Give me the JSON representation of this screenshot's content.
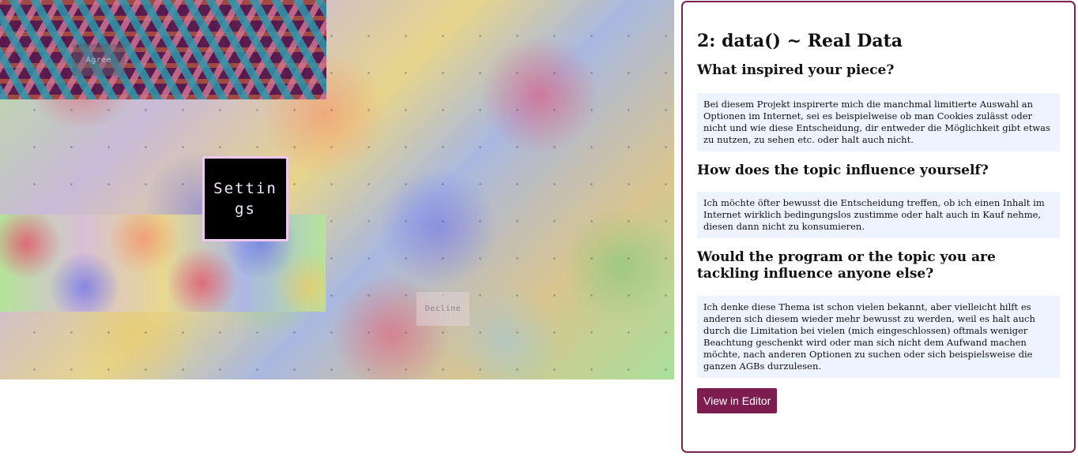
{
  "sketch": {
    "agree_label": "Agree",
    "decline_label": "Decline",
    "settings_label": "Settings"
  },
  "card": {
    "title": "2: data() ~ Real Data",
    "questions": [
      {
        "question": "What inspired your piece?",
        "answer": "Bei diesem Projekt inspirerte mich die manchmal limitierte Auswahl an Optionen im Internet, sei es beispielweise ob man Cookies zulässt oder nicht und wie diese Entscheidung, dir entweder die Möglichkeit gibt etwas zu nutzen, zu sehen etc. oder halt auch nicht."
      },
      {
        "question": "How does the topic influence yourself?",
        "answer": "Ich möchte öfter bewusst die Entscheidung treffen, ob ich einen Inhalt im Internet wirklich bedingungslos zustimme oder halt auch in Kauf nehme, diesen dann nicht zu konsumieren."
      },
      {
        "question": "Would the program or the topic you are tackling influence anyone else?",
        "answer": "Ich denke diese Thema ist schon vielen bekannt, aber vielleicht hilft es anderen sich diesem wieder mehr bewusst zu werden, weil es halt auch durch die Limitation bei vielen (mich eingeschlossen) oftmals weniger Beachtung geschenkt wird oder man sich nicht dem Aufwand machen möchte, nach anderen Optionen zu suchen oder sich beispielsweise die ganzen AGBs durzulesen."
      }
    ],
    "editor_button": "View in Editor"
  },
  "colors": {
    "accent": "#7d1c4f",
    "card_border": "#7a2452",
    "answer_bg": "#eef4ff",
    "settings_border": "#f0c8ef"
  }
}
